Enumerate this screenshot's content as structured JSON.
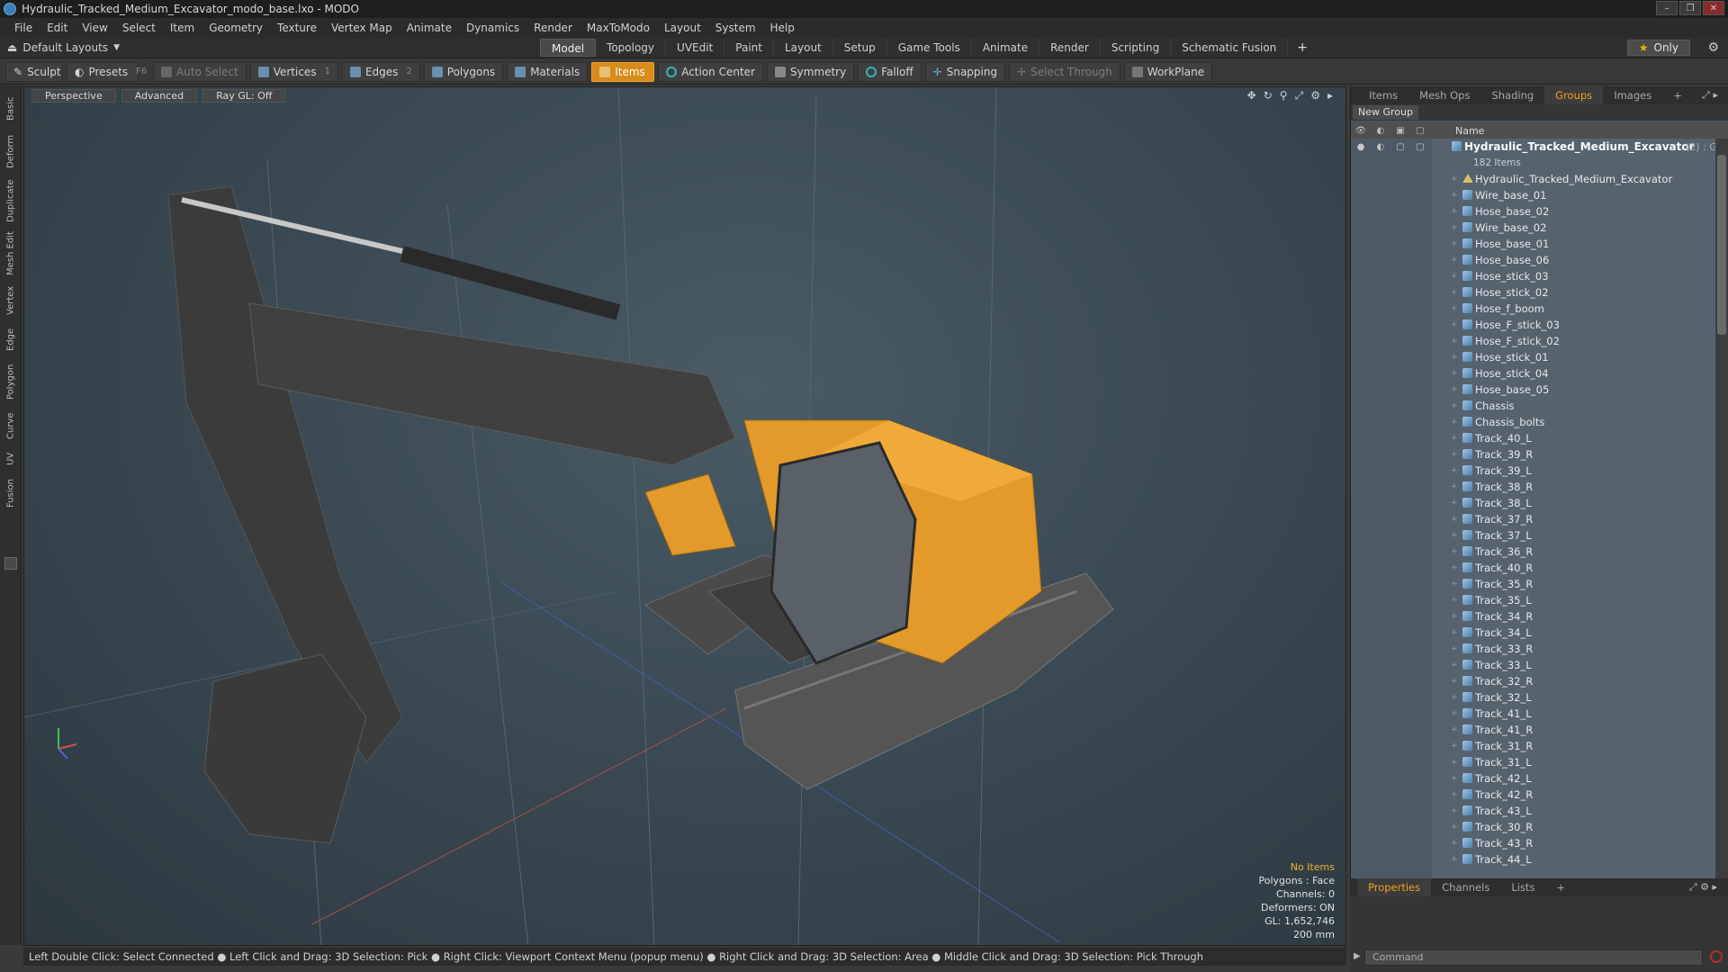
{
  "window": {
    "title": "Hydraulic_Tracked_Medium_Excavator_modo_base.lxo - MODO",
    "controls": [
      "–",
      "❐",
      "✕"
    ]
  },
  "menu": [
    "File",
    "Edit",
    "View",
    "Select",
    "Item",
    "Geometry",
    "Texture",
    "Vertex Map",
    "Animate",
    "Dynamics",
    "Render",
    "MaxToModo",
    "Layout",
    "System",
    "Help"
  ],
  "layouts": {
    "dropdown": "Default Layouts",
    "tabs": [
      "Model",
      "Topology",
      "UVEdit",
      "Paint",
      "Layout",
      "Setup",
      "Game Tools",
      "Animate",
      "Render",
      "Scripting",
      "Schematic Fusion"
    ],
    "active_tab": "Model",
    "only_label": "Only"
  },
  "toolbar": {
    "sculpt": "Sculpt",
    "presets": "Presets",
    "presets_key": "F6",
    "auto_select": "Auto Select",
    "vertices": "Vertices",
    "vertices_key": "1",
    "edges": "Edges",
    "edges_key": "2",
    "polygons": "Polygons",
    "materials": "Materials",
    "items": "Items",
    "action_center": "Action Center",
    "symmetry": "Symmetry",
    "falloff": "Falloff",
    "snapping": "Snapping",
    "select_through": "Select Through",
    "workplane": "WorkPlane"
  },
  "left_tabs": [
    "Basic",
    "Deform",
    "Duplicate",
    "Mesh Edit",
    "Vertex",
    "Edge",
    "Polygon",
    "Curve",
    "UV",
    "Fusion"
  ],
  "viewport": {
    "view_mode": "Perspective",
    "shading": "Advanced",
    "raygl": "Ray GL: Off",
    "stats": {
      "selection": "No Items",
      "polygons": "Polygons : Face",
      "channels": "Channels: 0",
      "deformers": "Deformers: ON",
      "gl": "GL: 1,652,746",
      "unit": "200 mm"
    }
  },
  "status_bar": "Left Double Click: Select Connected ● Left Click and Drag: 3D Selection: Pick ● Right Click: Viewport Context Menu (popup menu) ● Right Click and Drag: 3D Selection: Area ● Middle Click and Drag: 3D Selection: Pick Through",
  "right_panel": {
    "tabs": [
      "Items",
      "Mesh Ops",
      "Shading",
      "Groups",
      "Images"
    ],
    "active_tab": "Groups",
    "new_group": "New Group",
    "column_name": "Name",
    "group": {
      "name": "Hydraulic_Tracked_Medium_Excavator",
      "count": "(2) : G...",
      "sub": "182 Items"
    },
    "items": [
      "Hydraulic_Tracked_Medium_Excavator",
      "Wire_base_01",
      "Hose_base_02",
      "Wire_base_02",
      "Hose_base_01",
      "Hose_base_06",
      "Hose_stick_03",
      "Hose_stick_02",
      "Hose_f_boom",
      "Hose_F_stick_03",
      "Hose_F_stick_02",
      "Hose_stick_01",
      "Hose_stick_04",
      "Hose_base_05",
      "Chassis",
      "Chassis_bolts",
      "Track_40_L",
      "Track_39_R",
      "Track_39_L",
      "Track_38_R",
      "Track_38_L",
      "Track_37_R",
      "Track_37_L",
      "Track_36_R",
      "Track_40_R",
      "Track_35_R",
      "Track_35_L",
      "Track_34_R",
      "Track_34_L",
      "Track_33_R",
      "Track_33_L",
      "Track_32_R",
      "Track_32_L",
      "Track_41_L",
      "Track_41_R",
      "Track_31_R",
      "Track_31_L",
      "Track_42_L",
      "Track_42_R",
      "Track_43_L",
      "Track_30_R",
      "Track_43_R",
      "Track_44_L"
    ]
  },
  "bottom_panel": {
    "tabs": [
      "Properties",
      "Channels",
      "Lists"
    ],
    "active_tab": "Properties",
    "command_placeholder": "Command"
  }
}
